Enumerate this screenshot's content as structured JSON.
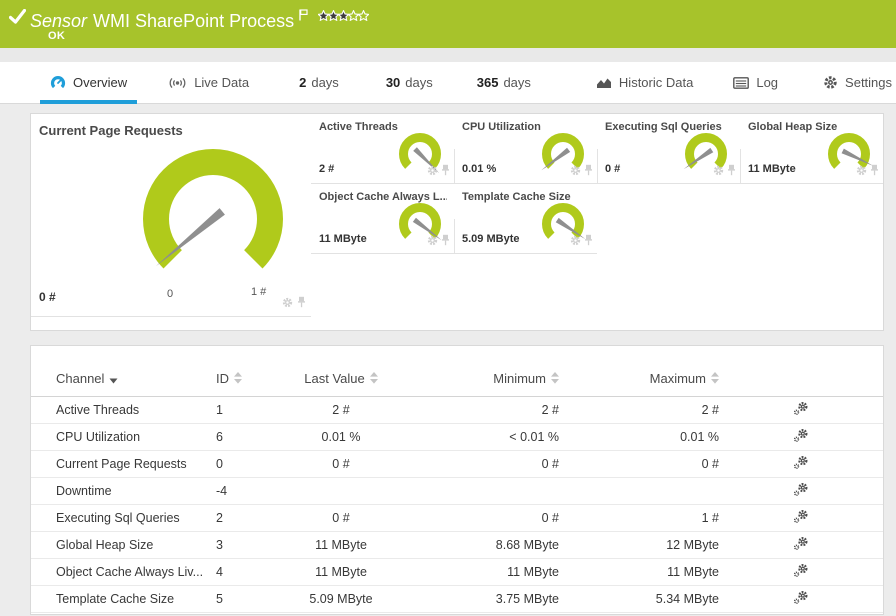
{
  "colors": {
    "header_green": "#a7c32b",
    "gauge_green": "#b0ca1b",
    "tab_blue": "#1f9ed9",
    "needle_gray": "#8f8f8f"
  },
  "header": {
    "sensor_label": "Sensor",
    "sensor_name": "WMI SharePoint Process",
    "status": "OK",
    "priority_filled": 3,
    "priority_total": 5,
    "icons": {
      "status": "check-icon",
      "flag": "flag-icon",
      "priority": "star-rating"
    }
  },
  "tabs": [
    {
      "label": "Overview",
      "icon": "gauge-icon",
      "active": true
    },
    {
      "label": "Live Data",
      "icon": "live-data-icon"
    },
    {
      "num": "2",
      "label": "days"
    },
    {
      "num": "30",
      "label": "days"
    },
    {
      "num": "365",
      "label": "days"
    },
    {
      "label": "Historic Data",
      "icon": "chart-icon"
    },
    {
      "label": "Log",
      "icon": "log-icon"
    },
    {
      "label": "Settings",
      "icon": "gear-icon"
    }
  ],
  "gauges": {
    "primary": {
      "title": "Current Page Requests",
      "value": "0 #",
      "scale_min": "0",
      "scale_max": "1 #",
      "fraction": 0.02
    },
    "small": [
      {
        "title": "Active Threads",
        "value": "2 #",
        "fraction": 1.0
      },
      {
        "title": "CPU Utilization",
        "value": "0.01 %",
        "fraction": 0.03
      },
      {
        "title": "Executing Sql Queries",
        "value": "0 #",
        "fraction": 0.04
      },
      {
        "title": "Global Heap Size",
        "value": "11 MByte",
        "fraction": 0.93
      },
      {
        "title": "Object Cache Always L...",
        "value": "11 MByte",
        "fraction": 0.97
      },
      {
        "title": "Template Cache Size",
        "value": "5.09 MByte",
        "fraction": 0.96
      }
    ]
  },
  "table": {
    "columns": [
      {
        "label": "Channel",
        "sort": "desc"
      },
      {
        "label": "ID",
        "sort": "none"
      },
      {
        "label": "Last Value",
        "sort": "none"
      },
      {
        "label": "Minimum",
        "sort": "none"
      },
      {
        "label": "Maximum",
        "sort": "none"
      }
    ],
    "rows": [
      {
        "channel": "Active Threads",
        "id": "1",
        "last": "2 #",
        "min": "2 #",
        "max": "2 #"
      },
      {
        "channel": "CPU Utilization",
        "id": "6",
        "last": "0.01 %",
        "min": "< 0.01 %",
        "max": "0.01 %"
      },
      {
        "channel": "Current Page Requests",
        "id": "0",
        "last": "0 #",
        "min": "0 #",
        "max": "0 #"
      },
      {
        "channel": "Downtime",
        "id": "-4",
        "last": "",
        "min": "",
        "max": ""
      },
      {
        "channel": "Executing Sql Queries",
        "id": "2",
        "last": "0 #",
        "min": "0 #",
        "max": "1 #"
      },
      {
        "channel": "Global Heap Size",
        "id": "3",
        "last": "11 MByte",
        "min": "8.68 MByte",
        "max": "12 MByte"
      },
      {
        "channel": "Object Cache Always Liv...",
        "id": "4",
        "last": "11 MByte",
        "min": "11 MByte",
        "max": "11 MByte"
      },
      {
        "channel": "Template Cache Size",
        "id": "5",
        "last": "5.09 MByte",
        "min": "3.75 MByte",
        "max": "5.34 MByte"
      }
    ]
  }
}
